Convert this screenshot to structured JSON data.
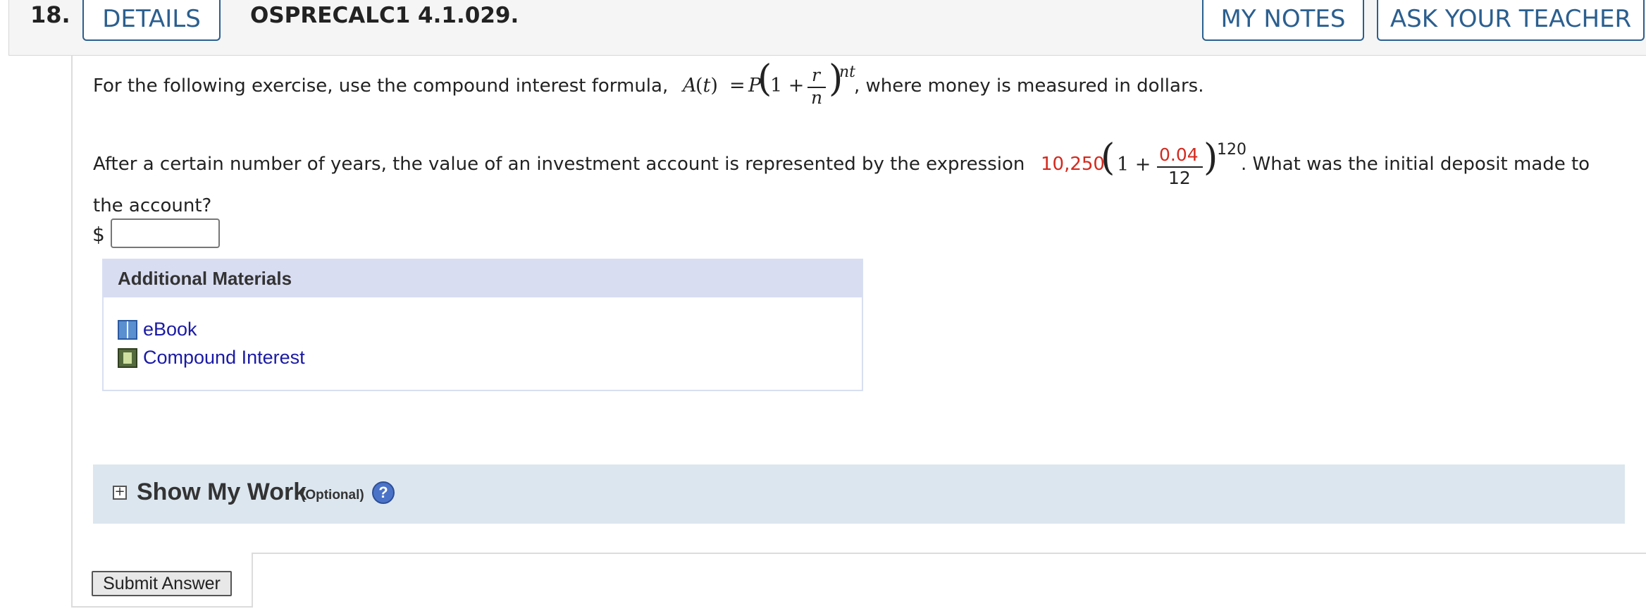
{
  "header": {
    "question_number": "18.",
    "details_label": "DETAILS",
    "question_code": "OSPRECALC1 4.1.029.",
    "my_notes_label": "MY NOTES",
    "ask_teacher_label": "ASK YOUR TEACHER"
  },
  "question": {
    "line1_prefix": "For the following exercise, use the compound interest formula,",
    "formula_lhs_A": "A",
    "formula_lhs_t": "(t)",
    "formula_eq": "=",
    "formula_P": "P",
    "formula_one_plus": "1 +",
    "formula_num": "r",
    "formula_den": "n",
    "formula_exp": "nt",
    "line1_suffix": ", where money is measured in dollars.",
    "line2_prefix": "After a certain number of years, the value of an investment account is represented by the expression",
    "expr_coef": "10,250",
    "expr_one_plus": "1 +",
    "expr_num": "0.04",
    "expr_den": "12",
    "expr_exp": "120",
    "line2_suffix": ". What was the initial deposit made to",
    "line3": "the account?"
  },
  "answer": {
    "currency": "$",
    "value": ""
  },
  "materials": {
    "heading": "Additional Materials",
    "links": [
      {
        "label": "eBook",
        "icon": "book-icon"
      },
      {
        "label": "Compound Interest",
        "icon": "film-icon"
      }
    ]
  },
  "show_my_work": {
    "title": "Show My Work",
    "optional": "(Optional)",
    "help": "?"
  },
  "submit_label": "Submit Answer"
}
